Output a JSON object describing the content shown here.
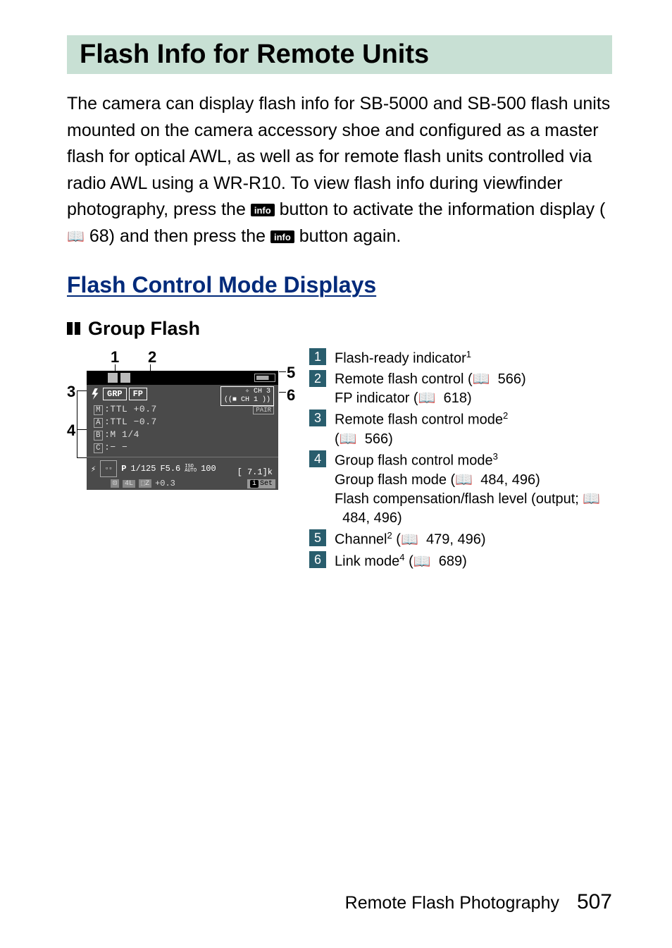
{
  "title": "Flash Info for Remote Units",
  "intro_part1": "The camera can display flash info for SB-5000 and SB-500 flash units mounted on the camera accessory shoe and configured as a master flash for optical AWL, as well as for remote flash units controlled via radio AWL using a WR-R10. To view flash info during viewfinder photography, press the ",
  "intro_part2": " button to activate the information display (",
  "intro_ref": "68",
  "intro_part3": ") and then press the ",
  "intro_part4": " button again.",
  "info_label": "info",
  "subtitle": "Flash Control Mode Displays",
  "group_label": "Group Flash",
  "callouts": {
    "c1": "1",
    "c2": "2",
    "c3": "3",
    "c4": "4",
    "c5": "5",
    "c6": "6"
  },
  "lcd": {
    "grp": "GRP",
    "fp": "FP",
    "ch_line1": "✧ CH 3",
    "ch_line2": "((■ CH 1 ))",
    "pair": "PAIR",
    "row_m": "M",
    "row_m_val": ":TTL      +0.7",
    "row_a": "A",
    "row_a_val": ":TTL      −0.7",
    "row_b": "B",
    "row_b_val": ":M   1/4",
    "row_c": "C",
    "row_c_val": ":− −",
    "bolt": "⚡",
    "focus": "▫▫",
    "mode_p": "P",
    "shutter": "1/125",
    "aperture": "F5.6",
    "iso_label_top": "ISO",
    "iso_label_bot": "AUTO",
    "iso": "100",
    "mtr": "⊡",
    "pv": "4L",
    "wb": "⬚Z",
    "ev": "+0.3",
    "count": "[  7.1]k",
    "set_i": "i",
    "set": "Set"
  },
  "legend": [
    {
      "num": "1",
      "lines": [
        {
          "text": "Flash-ready indicator",
          "sup": "1"
        }
      ]
    },
    {
      "num": "2",
      "lines": [
        {
          "text": "Remote flash control (",
          "book": true,
          "ref": "566",
          "close": ")"
        },
        {
          "text": "FP indicator (",
          "book": true,
          "ref": "618",
          "close": ")"
        }
      ]
    },
    {
      "num": "3",
      "lines": [
        {
          "text": "Remote flash control mode",
          "sup": "2"
        },
        {
          "text": "(",
          "book": true,
          "ref": "566",
          "close": ")"
        }
      ]
    },
    {
      "num": "4",
      "lines": [
        {
          "text": "Group flash control mode",
          "sup": "3"
        },
        {
          "text": "Group flash mode (",
          "book": true,
          "ref": "484, 496",
          "close": ")"
        },
        {
          "text": "Flash compensation/flash level (output; ",
          "book": true,
          "ref": "484, 496",
          "close": ")"
        }
      ]
    },
    {
      "num": "5",
      "lines": [
        {
          "text": "Channel",
          "sup": "2",
          "post": " (",
          "book": true,
          "ref": "479, 496",
          "close": ")"
        }
      ]
    },
    {
      "num": "6",
      "lines": [
        {
          "text": "Link mode",
          "sup": "4",
          "post": " (",
          "book": true,
          "ref": "689",
          "close": ")"
        }
      ]
    }
  ],
  "footer_text": "Remote Flash Photography",
  "page_number": "507"
}
